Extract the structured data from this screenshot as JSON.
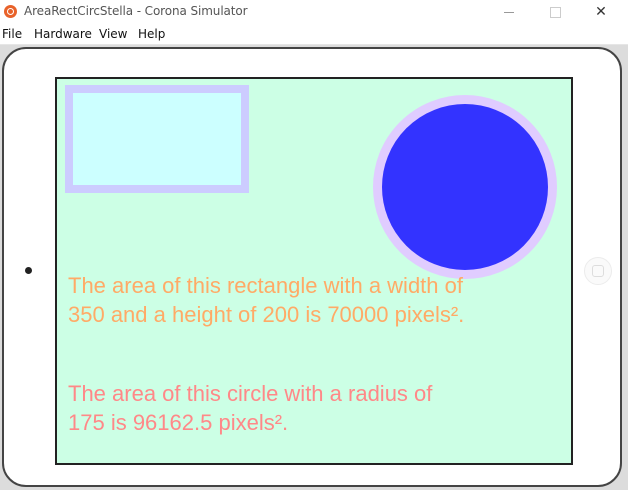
{
  "window": {
    "title": "AreaRectCircStella - Corona Simulator",
    "close_glyph": "✕"
  },
  "menu": [
    {
      "label": "File"
    },
    {
      "label": "Hardware"
    },
    {
      "label": "View"
    },
    {
      "label": "Help"
    }
  ],
  "screen": {
    "background_color": "#ccffe5",
    "rectangle": {
      "fill_color": "#ccffff",
      "stroke_color": "#ccccff"
    },
    "circle": {
      "fill_color": "#3333ff",
      "stroke_color": "#e0ccff"
    },
    "rect_text": {
      "line1": "The area of this rectangle with a width of",
      "line2": "350 and a height of 200 is 70000 pixels².",
      "color": "#ffaa66"
    },
    "circle_text": {
      "line1": "The area of this circle with a radius of",
      "line2": "175 is 96162.5 pixels².",
      "color": "#ff8888"
    }
  },
  "icons": {
    "app": "corona-app-icon",
    "minimize": "minimize-icon",
    "maximize": "maximize-icon",
    "close": "close-icon"
  }
}
